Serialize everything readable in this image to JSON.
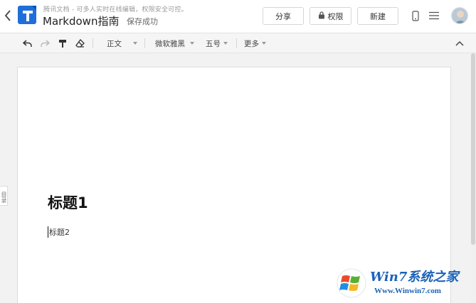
{
  "header": {
    "tagline": "腾讯文档 - 可多人实时在线编辑，权限安全可控。",
    "doc_title": "Markdown指南",
    "save_status": "保存成功",
    "buttons": {
      "share": "分享",
      "permission": "权限",
      "new": "新建"
    }
  },
  "toolbar": {
    "paragraph_style": "正文",
    "font_family": "微软雅黑",
    "font_size": "五号",
    "more": "更多"
  },
  "sidebar": {
    "outline_tab": "目录"
  },
  "document": {
    "heading1": "标题1",
    "heading2": "标题2"
  },
  "watermark": {
    "title": "Win7系统之家",
    "url": "Www.Winwin7.com"
  },
  "colors": {
    "brand_blue": "#1e6fd9",
    "watermark_blue": "#1c63b7"
  }
}
